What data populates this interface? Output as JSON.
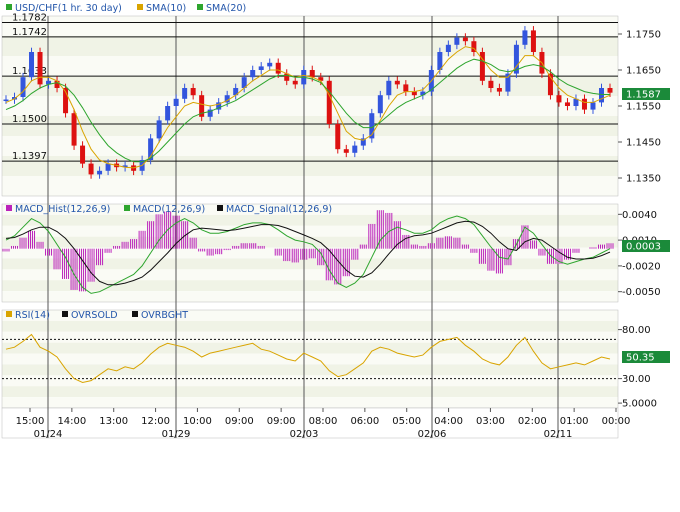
{
  "chart_data": {
    "type": "candlestick",
    "instrument": "USD/CHF",
    "price_panel": {
      "legend": [
        {
          "label": "USD/CHF(1 hr. 30 day)",
          "color": "#2ea52e"
        },
        {
          "label": "SMA(10)",
          "color": "#d9a400"
        },
        {
          "label": "SMA(20)",
          "color": "#2ea52e"
        }
      ],
      "yticks": [
        "1.1750",
        "1.1650",
        "1.1550",
        "1.1450",
        "1.1350"
      ],
      "ylim": [
        1.13,
        1.18
      ],
      "last_value": "1.1587",
      "levels": [
        {
          "label": "1.1782",
          "value": 1.1782
        },
        {
          "label": "1.1742",
          "value": 1.1742
        },
        {
          "label": "1.1633",
          "value": 1.1633
        },
        {
          "label": "1.1500",
          "value": 1.15
        },
        {
          "label": "1.1397",
          "value": 1.1397
        }
      ],
      "series": [
        {
          "name": "USD/CHF",
          "values": [
            1.1568,
            1.1575,
            1.163,
            1.17,
            1.161,
            1.162,
            1.16,
            1.153,
            1.144,
            1.139,
            1.136,
            1.137,
            1.139,
            1.138,
            1.1385,
            1.137,
            1.14,
            1.146,
            1.151,
            1.155,
            1.157,
            1.16,
            1.158,
            1.152,
            1.154,
            1.156,
            1.158,
            1.16,
            1.163,
            1.165,
            1.166,
            1.167,
            1.164,
            1.162,
            1.161,
            1.165,
            1.163,
            1.162,
            1.15,
            1.143,
            1.142,
            1.144,
            1.146,
            1.153,
            1.158,
            1.162,
            1.161,
            1.159,
            1.158,
            1.159,
            1.165,
            1.17,
            1.172,
            1.174,
            1.173,
            1.17,
            1.162,
            1.16,
            1.159,
            1.164,
            1.172,
            1.176,
            1.17,
            1.164,
            1.158,
            1.156,
            1.155,
            1.157,
            1.154,
            1.156,
            1.16,
            1.1587
          ]
        },
        {
          "name": "SMA(10)",
          "values": [
            1.156,
            1.157,
            1.159,
            1.162,
            1.163,
            1.163,
            1.162,
            1.159,
            1.154,
            1.148,
            1.143,
            1.14,
            1.139,
            1.1385,
            1.138,
            1.1378,
            1.1385,
            1.141,
            1.145,
            1.149,
            1.152,
            1.155,
            1.156,
            1.1555,
            1.155,
            1.1555,
            1.1565,
            1.158,
            1.16,
            1.162,
            1.1635,
            1.165,
            1.165,
            1.164,
            1.163,
            1.1635,
            1.163,
            1.162,
            1.158,
            1.153,
            1.148,
            1.146,
            1.1455,
            1.147,
            1.151,
            1.155,
            1.158,
            1.159,
            1.159,
            1.1595,
            1.162,
            1.165,
            1.168,
            1.17,
            1.1715,
            1.171,
            1.168,
            1.165,
            1.163,
            1.163,
            1.166,
            1.169,
            1.169,
            1.167,
            1.163,
            1.16,
            1.158,
            1.157,
            1.156,
            1.156,
            1.157,
            1.158
          ]
        },
        {
          "name": "SMA(20)",
          "values": [
            1.154,
            1.155,
            1.1565,
            1.1585,
            1.16,
            1.161,
            1.1615,
            1.1605,
            1.158,
            1.1545,
            1.1505,
            1.147,
            1.144,
            1.142,
            1.1405,
            1.1395,
            1.1395,
            1.1405,
            1.1425,
            1.145,
            1.1475,
            1.15,
            1.152,
            1.153,
            1.1535,
            1.1545,
            1.1555,
            1.1565,
            1.158,
            1.1595,
            1.161,
            1.1625,
            1.1635,
            1.1635,
            1.163,
            1.163,
            1.1625,
            1.1615,
            1.159,
            1.156,
            1.153,
            1.1505,
            1.149,
            1.149,
            1.1505,
            1.1525,
            1.1545,
            1.156,
            1.157,
            1.158,
            1.1595,
            1.1615,
            1.1635,
            1.1655,
            1.167,
            1.168,
            1.1675,
            1.1665,
            1.165,
            1.1645,
            1.165,
            1.166,
            1.1665,
            1.166,
            1.1645,
            1.1625,
            1.161,
            1.16,
            1.159,
            1.1585,
            1.1582,
            1.1582
          ]
        }
      ]
    },
    "macd_panel": {
      "legend": [
        {
          "label": "MACD_Hist(12,26,9)",
          "color": "#bb22bb"
        },
        {
          "label": "MACD(12,26,9)",
          "color": "#2ea52e"
        },
        {
          "label": "MACD_Signal(12,26,9)",
          "color": "#111111"
        }
      ],
      "yticks": [
        "0.0040",
        "0.0010",
        "-0.0020",
        "-0.0050"
      ],
      "ylim": [
        -0.0062,
        0.0052
      ],
      "last_value": "0.0003",
      "series": [
        {
          "name": "MACD(12,26,9)",
          "values": [
            0.001,
            0.0015,
            0.0025,
            0.0035,
            0.003,
            0.002,
            0.0005,
            -0.001,
            -0.003,
            -0.0045,
            -0.0052,
            -0.005,
            -0.0045,
            -0.004,
            -0.0035,
            -0.003,
            -0.002,
            -0.0005,
            0.001,
            0.0022,
            0.003,
            0.0035,
            0.003,
            0.0022,
            0.0018,
            0.0018,
            0.002,
            0.0024,
            0.0028,
            0.003,
            0.003,
            0.0028,
            0.0022,
            0.0015,
            0.001,
            0.0008,
            0.0005,
            -0.0005,
            -0.0025,
            -0.004,
            -0.0045,
            -0.004,
            -0.003,
            -0.001,
            0.001,
            0.002,
            0.0025,
            0.0022,
            0.0018,
            0.0018,
            0.0022,
            0.003,
            0.0035,
            0.0038,
            0.0035,
            0.0028,
            0.0015,
            0.0002,
            -0.001,
            -0.0012,
            0.0005,
            0.0025,
            0.0018,
            0.0005,
            -0.0008,
            -0.0015,
            -0.0018,
            -0.0015,
            -0.0012,
            -0.001,
            -0.0005,
            0.0
          ]
        },
        {
          "name": "MACD_Signal(12,26,9)",
          "values": [
            0.0012,
            0.0013,
            0.0017,
            0.0022,
            0.0025,
            0.0025,
            0.002,
            0.0012,
            0.0,
            -0.0014,
            -0.0028,
            -0.0038,
            -0.0042,
            -0.0042,
            -0.004,
            -0.0037,
            -0.0033,
            -0.0025,
            -0.0015,
            -0.0005,
            0.0006,
            0.0015,
            0.0022,
            0.0024,
            0.0023,
            0.0022,
            0.0021,
            0.0022,
            0.0024,
            0.0026,
            0.0028,
            0.0028,
            0.0027,
            0.0024,
            0.002,
            0.0016,
            0.0012,
            0.0007,
            -0.0002,
            -0.0014,
            -0.0025,
            -0.0032,
            -0.0033,
            -0.0028,
            -0.0018,
            -0.0006,
            0.0005,
            0.0012,
            0.0015,
            0.0016,
            0.0018,
            0.0022,
            0.0026,
            0.003,
            0.0032,
            0.0031,
            0.0026,
            0.0018,
            0.0008,
            0.0,
            -0.0002,
            0.0008,
            0.0012,
            0.001,
            0.0003,
            -0.0004,
            -0.001,
            -0.0012,
            -0.0012,
            -0.0011,
            -0.0008,
            -0.0004
          ]
        }
      ]
    },
    "rsi_panel": {
      "legend": [
        {
          "label": "RSI(14)",
          "color": "#d9a400"
        },
        {
          "label": "OVRSOLD",
          "color": "#111111"
        },
        {
          "label": "OVRBGHT",
          "color": "#111111"
        }
      ],
      "yticks": [
        "80.00",
        "30.00",
        "5.0000"
      ],
      "ylim": [
        0,
        100
      ],
      "overbought": 70,
      "oversold": 30,
      "last_value": "50.35",
      "series": [
        {
          "name": "RSI(14)",
          "values": [
            60,
            62,
            68,
            75,
            62,
            58,
            52,
            40,
            30,
            26,
            28,
            34,
            40,
            38,
            42,
            40,
            46,
            55,
            62,
            66,
            64,
            62,
            58,
            52,
            56,
            58,
            60,
            62,
            64,
            66,
            60,
            58,
            54,
            50,
            48,
            56,
            52,
            48,
            38,
            32,
            34,
            40,
            46,
            58,
            62,
            60,
            56,
            54,
            52,
            54,
            62,
            68,
            70,
            72,
            64,
            58,
            50,
            46,
            44,
            52,
            64,
            72,
            58,
            46,
            40,
            42,
            44,
            46,
            44,
            48,
            52,
            50
          ]
        }
      ]
    },
    "x_axis": {
      "ticks": [
        "15:00",
        "14:00",
        "13:00",
        "12:00",
        "10:00",
        "09:00",
        "09:00",
        "08:00",
        "06:00",
        "05:00",
        "04:00",
        "03:00",
        "02:00",
        "01:00",
        "00:00"
      ],
      "dates": [
        "01/24",
        "01/29",
        "02/03",
        "02/06",
        "02/11"
      ]
    },
    "colors": {
      "up": "#3355dd",
      "down": "#dd1111",
      "band": "#f0f3e6",
      "band_alt": "#fafbf5"
    }
  }
}
